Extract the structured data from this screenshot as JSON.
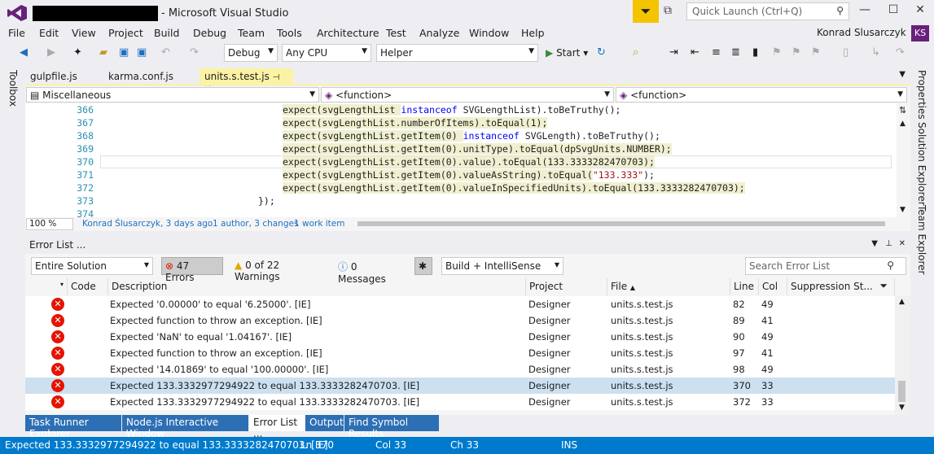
{
  "title": "- Microsoft Visual Studio",
  "quick_launch": "Quick Launch (Ctrl+Q)",
  "user": "Konrad Slusarczyk",
  "user_initials": "KS",
  "menu": [
    "File",
    "Edit",
    "View",
    "Project",
    "Build",
    "Debug",
    "Team",
    "Tools",
    "Architecture",
    "Test",
    "Analyze",
    "Window",
    "Help"
  ],
  "toolbar": {
    "config": "Debug",
    "platform": "Any CPU",
    "project": "Helper",
    "start": "Start"
  },
  "side": {
    "left": "Toolbox",
    "right": [
      "Properties",
      "Solution Explorer",
      "Team Explorer"
    ]
  },
  "doc_tabs": [
    "gulpfile.js",
    "karma.conf.js",
    "units.s.test.js"
  ],
  "nav": {
    "scope": "Miscellaneous",
    "func1": "<function>",
    "func2": "<function>"
  },
  "code_lines": [
    {
      "n": "366",
      "pre": "expect(svgLengthList ",
      "kw": "instanceof",
      "post": " SVGLengthList).toBeTruthy();",
      "str": ""
    },
    {
      "n": "367",
      "pre": "expect(svgLengthList.numberOfItems).toEqual(1);",
      "kw": "",
      "post": "",
      "str": ""
    },
    {
      "n": "368",
      "pre": "expect(svgLengthList.getItem(0) ",
      "kw": "instanceof",
      "post": " SVGLength).toBeTruthy();",
      "str": ""
    },
    {
      "n": "369",
      "pre": "expect(svgLengthList.getItem(0).unitType).toEqual(dpSvgUnits.NUMBER);",
      "kw": "",
      "post": "",
      "str": ""
    },
    {
      "n": "370",
      "pre": "expect(svgLengthList.getItem(0).value).toEqual(133.3333282470703);",
      "kw": "",
      "post": "",
      "str": ""
    },
    {
      "n": "371",
      "pre": "expect(svgLengthList.getItem(0).valueAsString).toEqual(",
      "kw": "",
      "post": ");",
      "str": "\"133.333\""
    },
    {
      "n": "372",
      "pre": "expect(svgLengthList.getItem(0).valueInSpecifiedUnits).toEqual(133.3333282470703);",
      "kw": "",
      "post": "",
      "str": ""
    },
    {
      "n": "373",
      "pre": "});",
      "kw": "",
      "post": "",
      "str": ""
    },
    {
      "n": "374",
      "pre": "",
      "kw": "",
      "post": "",
      "str": ""
    }
  ],
  "editor_status": {
    "zoom": "100 %",
    "author": "Konrad Ślusarczyk, 3 days ago",
    "changes": "1 author, 3 changes",
    "workitem": "1 work item"
  },
  "error_list": {
    "title": "Error List ...",
    "scope": "Entire Solution",
    "errors": "47 Errors",
    "warnings": "0 of 22 Warnings",
    "messages": "0 Messages",
    "build": "Build + IntelliSense",
    "search": "Search Error List",
    "headers": {
      "code": "Code",
      "description": "Description",
      "project": "Project",
      "file": "File",
      "line": "Line",
      "col": "Col",
      "suppression": "Suppression St..."
    },
    "rows": [
      {
        "desc": "Expected '0.00000' to equal '6.25000'. [IE]",
        "project": "Designer",
        "file": "units.s.test.js",
        "line": "82",
        "col": "49"
      },
      {
        "desc": "Expected function to throw an exception. [IE]",
        "project": "Designer",
        "file": "units.s.test.js",
        "line": "89",
        "col": "41"
      },
      {
        "desc": "Expected 'NaN' to equal '1.04167'. [IE]",
        "project": "Designer",
        "file": "units.s.test.js",
        "line": "90",
        "col": "49"
      },
      {
        "desc": "Expected function to throw an exception. [IE]",
        "project": "Designer",
        "file": "units.s.test.js",
        "line": "97",
        "col": "41"
      },
      {
        "desc": "Expected '14.01869' to equal '100.00000'. [IE]",
        "project": "Designer",
        "file": "units.s.test.js",
        "line": "98",
        "col": "49"
      },
      {
        "desc": "Expected 133.3332977294922 to equal 133.3333282470703. [IE]",
        "project": "Designer",
        "file": "units.s.test.js",
        "line": "370",
        "col": "33"
      },
      {
        "desc": "Expected 133.3332977294922 to equal 133.3333282470703. [IE]",
        "project": "Designer",
        "file": "units.s.test.js",
        "line": "372",
        "col": "33"
      }
    ]
  },
  "bottom_tabs": [
    "Task Runner Explorer",
    "Node.js Interactive Window",
    "Error List ...",
    "Output",
    "Find Symbol Results"
  ],
  "status": {
    "message": "Expected 133.3332977294922 to equal 133.3333282470703. [IE]",
    "ln": "Ln 370",
    "col": "Col 33",
    "ch": "Ch 33",
    "mode": "INS"
  },
  "colors": {
    "accent": "#007acc",
    "vs_purple": "#68217a",
    "error_red": "#e51400",
    "tab_yellow": "#fbf2a4"
  }
}
